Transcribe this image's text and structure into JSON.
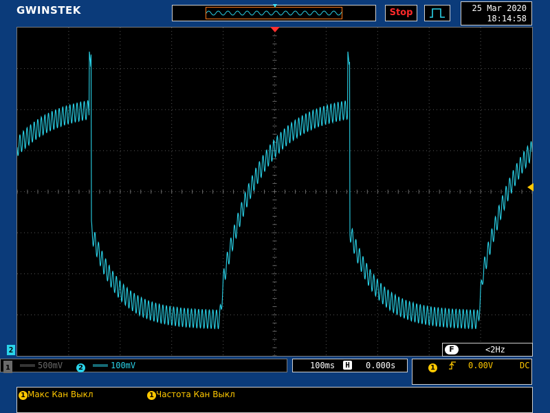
{
  "brand": {
    "logo": "GWINSTEK"
  },
  "header": {
    "run_state": "Stop",
    "trigger_icon": "edge-pulse-icon",
    "date": "25 Mar 2020",
    "time": "18:14:58"
  },
  "channels": {
    "ch1": {
      "number": "1",
      "scale": "500mV",
      "color": "#6a6a6a",
      "enabled": false
    },
    "ch2": {
      "number": "2",
      "scale": "100mV",
      "color": "#2ad4ea",
      "enabled": true
    }
  },
  "timebase": {
    "scale": "100ms",
    "position_icon": "H",
    "position": "0.000s"
  },
  "trigger": {
    "source": "1",
    "slope_icon": "rising-edge-icon",
    "level": "0.00V",
    "coupling": "DC"
  },
  "filter": {
    "icon_label": "F",
    "text": "<2Hz"
  },
  "measurements": [
    {
      "channel": "1",
      "label": "Макс Кан Выкл"
    },
    {
      "channel": "1",
      "label": "Частота Кан Выкл"
    }
  ],
  "colors": {
    "trace": "#2ad4ea",
    "trigger": "#ffc800",
    "stop": "#ff2a2a",
    "frame": "#0b3b7a",
    "overview_window": "#ff7a1a"
  }
}
